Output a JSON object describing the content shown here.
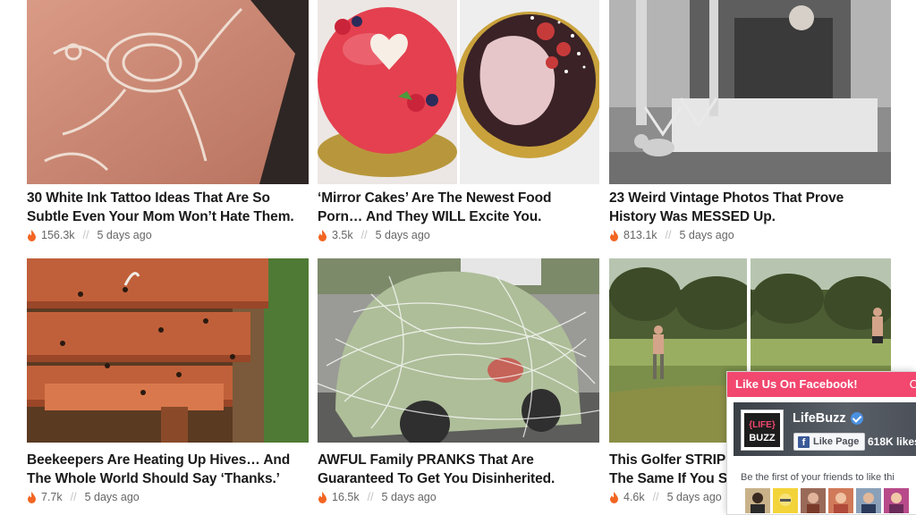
{
  "articles": [
    {
      "title_line1": "30 White Ink Tattoo Ideas That Are So",
      "title_line2": "Subtle Even Your Mom Won’t Hate Them.",
      "views": "156.3k",
      "time": "5 days ago"
    },
    {
      "title_line1": "‘Mirror Cakes’ Are The Newest Food",
      "title_line2": "Porn… And They WILL Excite You.",
      "views": "3.5k",
      "time": "5 days ago"
    },
    {
      "title_line1": "23 Weird Vintage Photos That Prove",
      "title_line2": "History Was MESSED Up.",
      "views": "813.1k",
      "time": "5 days ago"
    },
    {
      "title_line1": "Beekeepers Are Heating Up Hives… And",
      "title_line2": "The Whole World Should Say ‘Thanks.’",
      "views": "7.7k",
      "time": "5 days ago"
    },
    {
      "title_line1": "AWFUL Family PRANKS That Are",
      "title_line2": "Guaranteed To Get You Disinherited.",
      "views": "16.5k",
      "time": "5 days ago"
    },
    {
      "title_line1": "This Golfer STRIP",
      "title_line2": "The Same If You S",
      "views": "4.6k",
      "time": "5 days ago"
    }
  ],
  "separator": "//",
  "facebook": {
    "header": "Like Us On Facebook!",
    "close": "C",
    "page_name": "LifeBuzz",
    "like_button": "Like Page",
    "likes": "618K likes",
    "friends_text": "Be the first of your friends to like thi",
    "logo_top": "{LIFE}",
    "logo_bottom": "BUZZ"
  },
  "colors": {
    "accent": "#f2476e",
    "flame": "#f26522",
    "facebook": "#3b5998"
  }
}
